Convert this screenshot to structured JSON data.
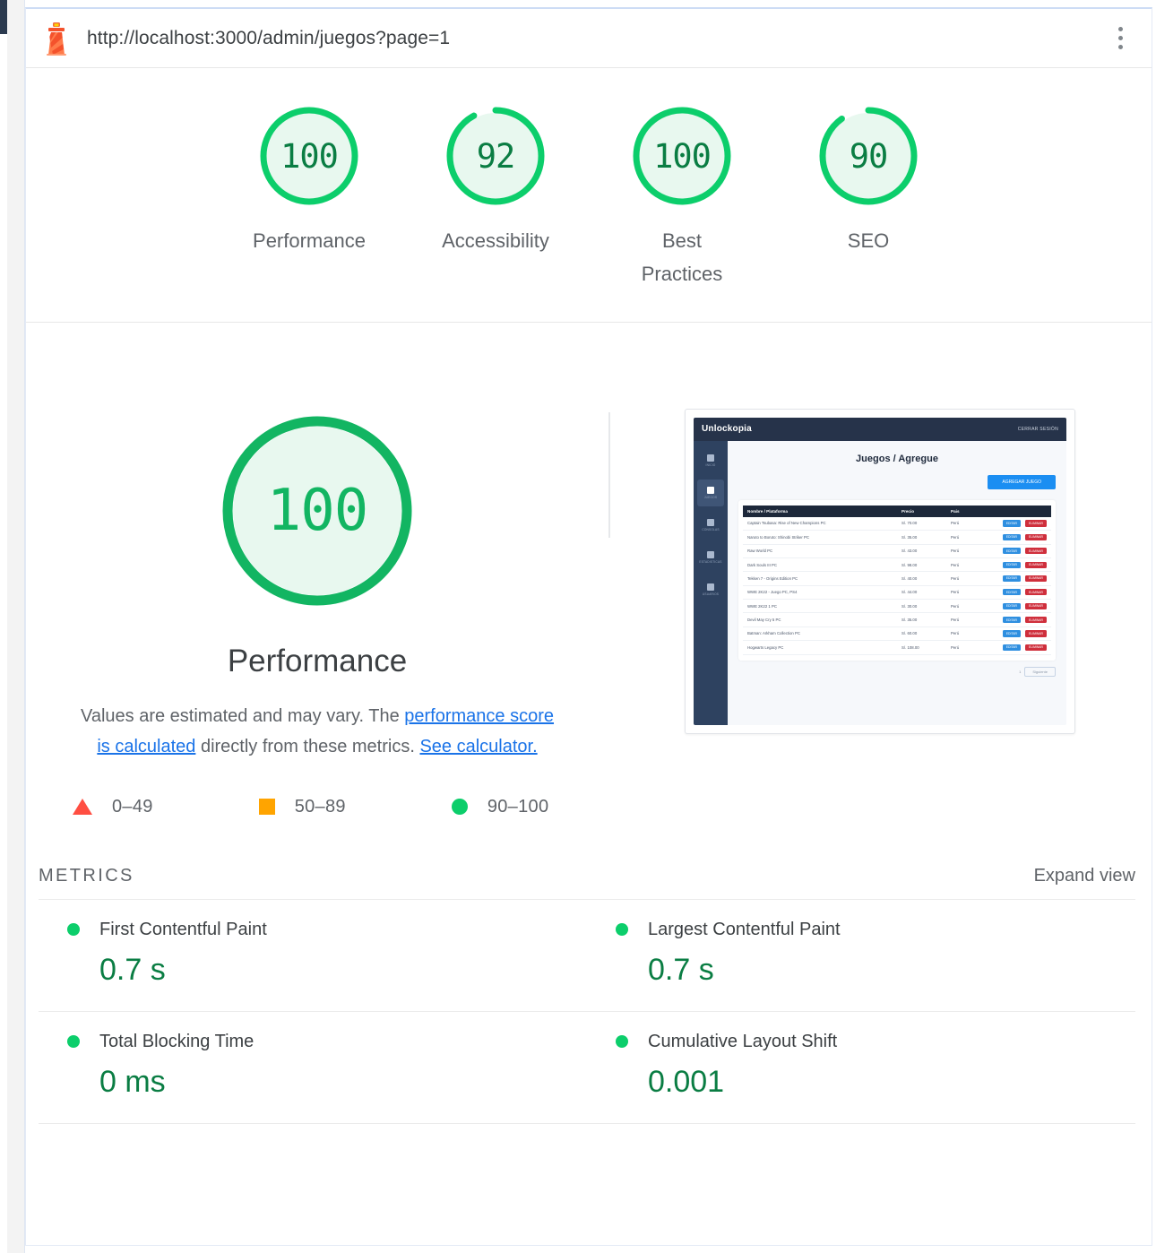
{
  "topbar": {
    "logo_icon": "lighthouse-icon",
    "url": "http://localhost:3000/admin/juegos?page=1",
    "menu_icon": "kebab-menu-icon"
  },
  "category_scores": [
    {
      "label": "Performance",
      "value": "100",
      "pct": 100,
      "color": "#0cce6b"
    },
    {
      "label": "Accessibility",
      "value": "92",
      "pct": 92,
      "color": "#0cce6b"
    },
    {
      "label": "Best Practices",
      "value": "100",
      "pct": 100,
      "color": "#0cce6b"
    },
    {
      "label": "SEO",
      "value": "90",
      "pct": 90,
      "color": "#0cce6b"
    }
  ],
  "performance": {
    "score": "100",
    "pct": 100,
    "title": "Performance",
    "disclaimer": {
      "part1": "Values are estimated and may vary. The ",
      "link1": "performance score is calculated",
      "part2": " directly from these metrics. ",
      "link2": "See calculator."
    },
    "legend": [
      {
        "shape": "triangle",
        "range": "0–49",
        "color": "#ff4e42"
      },
      {
        "shape": "square",
        "range": "50–89",
        "color": "#ffa400"
      },
      {
        "shape": "circle",
        "range": "90–100",
        "color": "#0cce6b"
      }
    ]
  },
  "thumbnail": {
    "brand": "Unlockopia",
    "logout": "CERRAR SESIÓN",
    "sidebar": [
      {
        "label": "INICIO",
        "icon": "home-icon",
        "active": false
      },
      {
        "label": "JUEGOS",
        "icon": "gamepad-icon",
        "active": true
      },
      {
        "label": "CONSOLAS",
        "icon": "console-icon",
        "active": false
      },
      {
        "label": "ESTADISTICAS",
        "icon": "chart-icon",
        "active": false
      },
      {
        "label": "USUARIOS",
        "icon": "users-icon",
        "active": false
      }
    ],
    "heading": "Juegos / Agregue",
    "add_button": "AGREGAR JUEGO",
    "table": {
      "columns": [
        "Nombre / Plataforma",
        "Precio",
        "Pais",
        ""
      ],
      "rows": [
        [
          "Captain Tsubasa: Rise of New Champions PC",
          "S/. 70.00",
          "Perú",
          "EDITAR",
          "ELIMINAR"
        ],
        [
          "Naruto to Boruto: Shinobi Striker PC",
          "S/. 35.00",
          "Perú",
          "EDITAR",
          "ELIMINAR"
        ],
        [
          "Raw World PC",
          "S/. 43.00",
          "Perú",
          "EDITAR",
          "ELIMINAR"
        ],
        [
          "Dark Souls III PC",
          "S/. 98.00",
          "Perú",
          "EDITAR",
          "ELIMINAR"
        ],
        [
          "Tekken 7 - Origins Edition PC",
          "S/. 40.00",
          "Perú",
          "EDITAR",
          "ELIMINAR"
        ],
        [
          "WWE 2K22 - Juego PC, PS4",
          "S/. 44.00",
          "Perú",
          "EDITAR",
          "ELIMINAR"
        ],
        [
          "WWE 2K22 1 PC",
          "S/. 30.00",
          "Perú",
          "EDITAR",
          "ELIMINAR"
        ],
        [
          "Devil May Cry 5 PC",
          "S/. 35.00",
          "Perú",
          "EDITAR",
          "ELIMINAR"
        ],
        [
          "Batman: Arkham Collection PC",
          "S/. 60.00",
          "Perú",
          "EDITAR",
          "ELIMINAR"
        ],
        [
          "Hogwarts Legacy PC",
          "S/. 108.00",
          "Perú",
          "EDITAR",
          "ELIMINAR"
        ]
      ]
    },
    "pagination": {
      "prev": "1",
      "next": "Siguiente"
    }
  },
  "metrics_section": {
    "title": "METRICS",
    "expand_label": "Expand view",
    "items": [
      {
        "name": "First Contentful Paint",
        "value": "0.7 s",
        "status": "pass"
      },
      {
        "name": "Largest Contentful Paint",
        "value": "0.7 s",
        "status": "pass"
      },
      {
        "name": "Total Blocking Time",
        "value": "0 ms",
        "status": "pass"
      },
      {
        "name": "Cumulative Layout Shift",
        "value": "0.001",
        "status": "pass"
      }
    ]
  }
}
